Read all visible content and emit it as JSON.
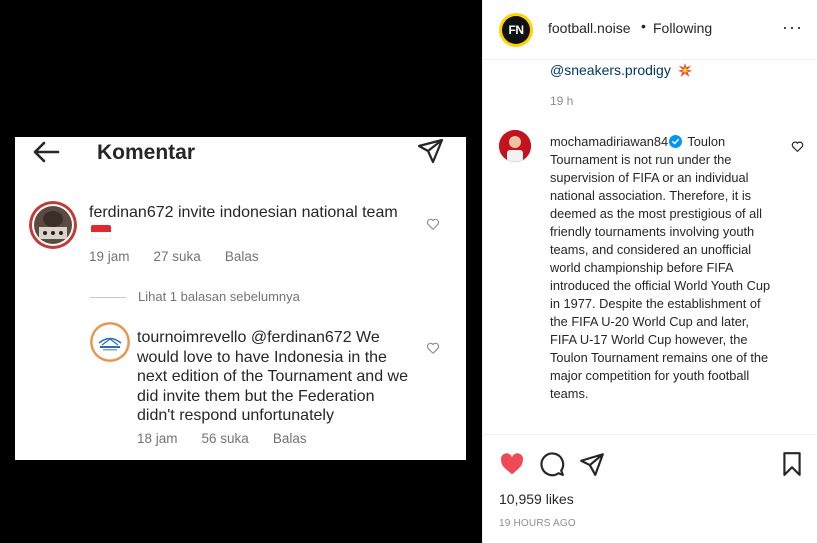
{
  "media": {
    "screenshot": {
      "title": "Komentar",
      "comment1": {
        "username": "ferdinan672",
        "text": " invite indonesian national team",
        "time": "19 jam",
        "likes": "27 suka",
        "reply": "Balas"
      },
      "view_replies": "Lihat 1 balasan sebelumnya",
      "comment2": {
        "username": "tournoimrevello",
        "mention": " @ferdinan672",
        "text": " We would love to have Indonesia in the next edition of the Tournament and we did invite them but the Federation didn't respond unfortunately",
        "time": "18 jam",
        "likes": "56 suka",
        "reply": "Balas"
      }
    }
  },
  "sidebar": {
    "header": {
      "avatar_text": "FN",
      "username": "football.noise",
      "separator": "•",
      "follow_status": "Following",
      "more": "···"
    },
    "caption": {
      "mention": "@sneakers.prodigy",
      "time": "19 h"
    },
    "comment": {
      "username": "mochamadiriawan84",
      "text": " Toulon Tournament is not run under the supervision of FIFA or an individual national association. Therefore, it is deemed as the most prestigious of all friendly tournaments involving youth teams, and considered an unofficial world championship before FIFA introduced the official World Youth Cup in 1977. Despite the establishment of the FIFA U-20 World Cup and later, FIFA U-17 World Cup however, the Toulon Tournament remains one of the major competition for youth football teams."
    },
    "likes": "10,959 likes",
    "time_ago": "19 HOURS AGO"
  },
  "colors": {
    "like_red": "#ed4956",
    "link_blue": "#00376b",
    "verified_blue": "#0095f6",
    "flag_red": "#e3262f"
  },
  "icons": [
    "back-arrow-icon",
    "send-icon",
    "heart-icon",
    "comment-icon",
    "share-icon",
    "bookmark-icon",
    "more-icon",
    "verified-icon",
    "collision-icon"
  ]
}
